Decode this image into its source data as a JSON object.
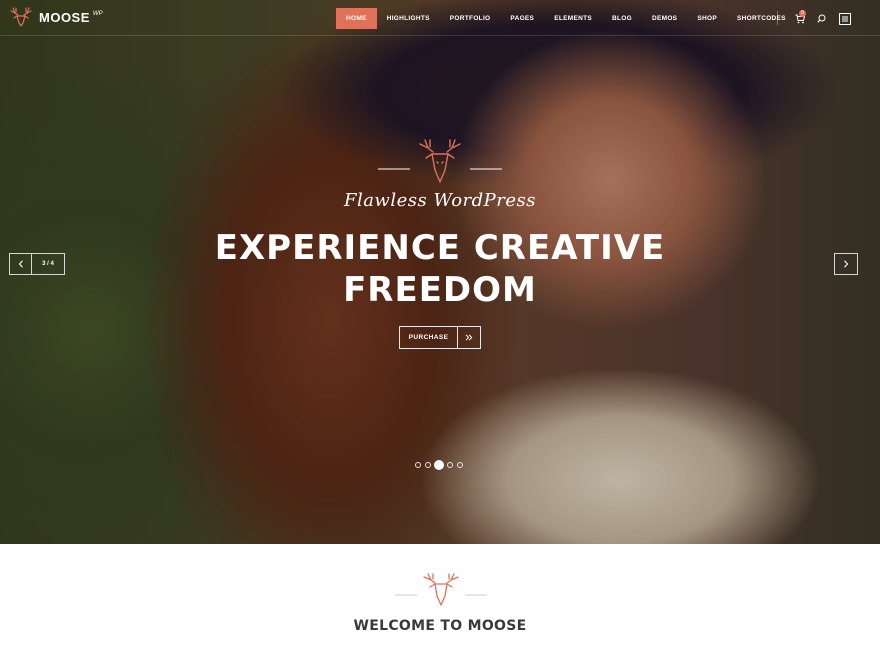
{
  "header": {
    "logo_text": "MOOSE",
    "logo_sup": "WP",
    "nav": [
      "HOME",
      "HIGHLIGHTS",
      "PORTFOLIO",
      "PAGES",
      "ELEMENTS",
      "BLOG",
      "DEMOS",
      "SHOP",
      "SHORTCODES"
    ],
    "active_nav": "HOME",
    "cart_count": "0",
    "icons": [
      "cart-icon",
      "search-icon",
      "menu-icon"
    ]
  },
  "hero": {
    "subtitle": "Flawless WordPress",
    "title_line1": "EXPERIENCE CREATIVE",
    "title_line2": "FREEDOM",
    "purchase_label": "PURCHASE",
    "slide_counter": "3 / 4",
    "dots_total": 5,
    "dots_active_index": 2
  },
  "welcome": {
    "title": "WELCOME TO MOOSE"
  },
  "colors": {
    "accent": "#e0715a",
    "heading_dark": "#3a3a3a",
    "white": "#ffffff"
  }
}
